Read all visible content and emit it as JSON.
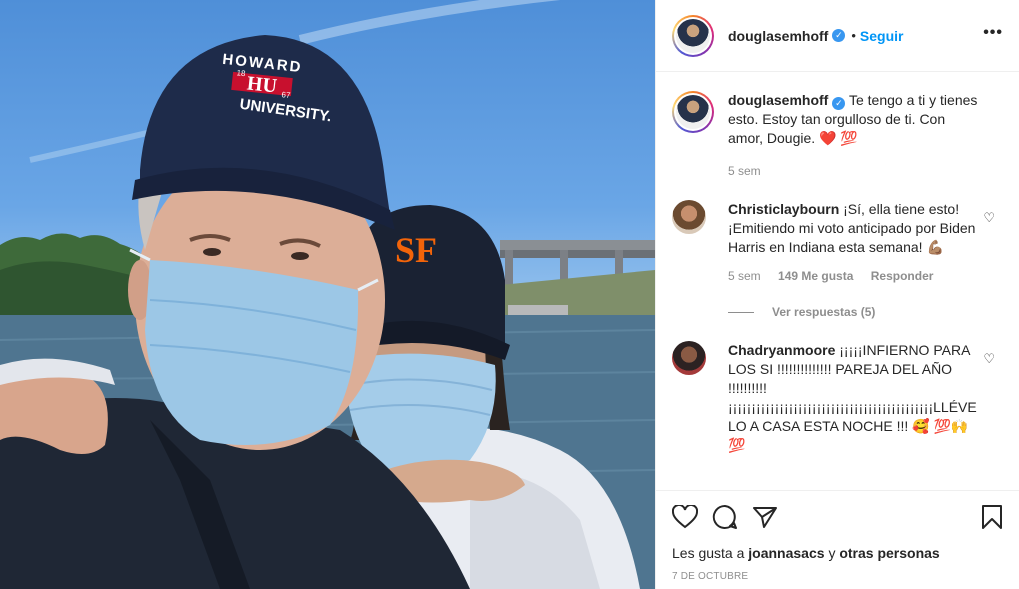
{
  "post": {
    "username": "douglasemhoff",
    "follow_label": "Seguir",
    "dot": "•",
    "more_label": "•••"
  },
  "caption": {
    "username": "douglasemhoff",
    "text": "Te tengo a ti y tienes esto. Estoy tan orgulloso de ti. Con amor, Dougie. ❤️ 💯",
    "time": "5 sem"
  },
  "comments": [
    {
      "username": "Christiclaybourn",
      "text": "¡Sí, ella tiene esto! ¡Emitiendo mi voto anticipado por Biden Harris en Indiana esta semana! 💪🏽",
      "time": "5 sem",
      "likes": "149 Me gusta",
      "reply_label": "Responder",
      "view_replies": "Ver respuestas (5)"
    },
    {
      "username": "Chadryanmoore",
      "text": "¡¡¡¡¡INFIERNO PARA LOS SI !!!!!!!!!!!!!! PAREJA DEL AÑO !!!!!!!!!! ¡¡¡¡¡¡¡¡¡¡¡¡¡¡¡¡¡¡¡¡¡¡¡¡¡¡¡¡¡¡¡¡¡¡¡¡¡¡¡¡¡¡¡¡LLÉVELO A CASA ESTA NOCHE !!! 🥰 💯🙌💯"
    }
  ],
  "footer": {
    "likes_prefix": "Les gusta a",
    "likes_user": "joannasacs",
    "likes_and": "y",
    "likes_others": "otras personas",
    "date": "7 DE OCTUBRE"
  },
  "photo": {
    "cap_text_top": "HOWARD",
    "cap_text_mid": "HU",
    "cap_year_left": "18",
    "cap_year_right": "67",
    "cap_text_bottom": "UNIVERSITY."
  },
  "icons": [
    "heart-icon",
    "comment-icon",
    "share-icon",
    "bookmark-icon",
    "verified-icon",
    "more-icon"
  ],
  "colors": {
    "link_blue": "#0095f6",
    "verified_blue": "#3897f0",
    "cap_navy": "#1e2b4a",
    "mask_blue": "#9cc7e6"
  }
}
